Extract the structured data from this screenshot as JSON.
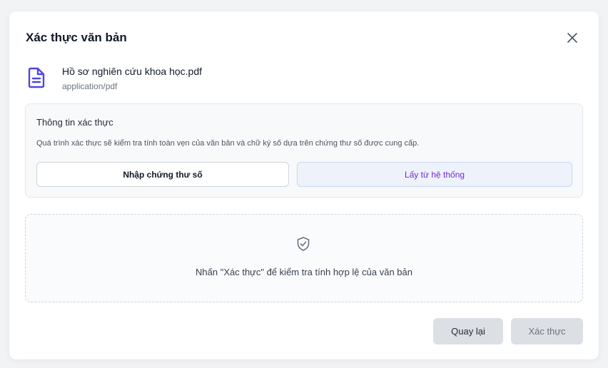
{
  "dialog": {
    "title": "Xác thực văn bản",
    "close_icon": "close-icon"
  },
  "file": {
    "icon": "document-icon",
    "name": "Hồ sơ nghiên cứu khoa học.pdf",
    "mime": "application/pdf",
    "icon_color": "#4f46e5"
  },
  "verification_info": {
    "title": "Thông tin xác thực",
    "description": "Quá trình xác thực sẽ kiểm tra tính toàn vẹn của văn bản và chữ ký số dựa trên chứng thư số được cung cấp.",
    "options": [
      {
        "label": "Nhập chứng thư số",
        "selected": false
      },
      {
        "label": "Lấy từ hệ thống",
        "selected": true
      }
    ],
    "selected_color": "#6d28d9"
  },
  "placeholder": {
    "icon": "shield-check-icon",
    "text": "Nhấn \"Xác thực\" để kiểm tra tính hợp lệ của văn bản"
  },
  "footer": {
    "back_label": "Quay lại",
    "verify_label": "Xác thực",
    "verify_disabled": true
  }
}
